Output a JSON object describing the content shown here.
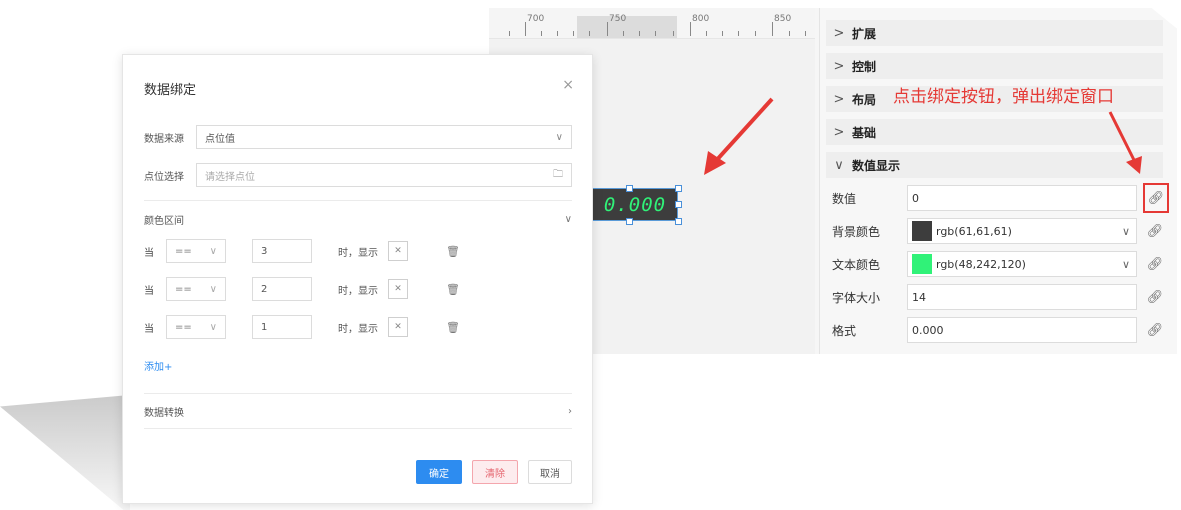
{
  "ruler": {
    "labels": [
      "700",
      "750",
      "800",
      "850"
    ]
  },
  "widget": {
    "display_value": "0.000"
  },
  "properties": {
    "groups": [
      {
        "chevron": ">",
        "label": "扩展"
      },
      {
        "chevron": ">",
        "label": "控制"
      },
      {
        "chevron": ">",
        "label": "布局"
      },
      {
        "chevron": ">",
        "label": "基础"
      },
      {
        "chevron": "∨",
        "label": "数值显示"
      }
    ],
    "rows": [
      {
        "label": "数值",
        "value": "0"
      },
      {
        "label": "背景颜色",
        "value": "rgb(61,61,61)",
        "swatch": "#3d3d3d"
      },
      {
        "label": "文本颜色",
        "value": "rgb(48,242,120)",
        "swatch": "#30f278"
      },
      {
        "label": "字体大小",
        "value": "14"
      },
      {
        "label": "格式",
        "value": "0.000"
      }
    ],
    "select_arrow": "∨"
  },
  "annotation": {
    "text": "点击绑定按钮，弹出绑定窗口"
  },
  "dialog": {
    "title": "数据绑定",
    "close": "×",
    "source_label": "数据来源",
    "source_value": "点位值",
    "point_label": "点位选择",
    "point_placeholder": "请选择点位",
    "color_range_label": "颜色区间",
    "conditions": [
      {
        "when": "当",
        "op": "==",
        "value": "3",
        "show": "时，显示"
      },
      {
        "when": "当",
        "op": "==",
        "value": "2",
        "show": "时，显示"
      },
      {
        "when": "当",
        "op": "==",
        "value": "1",
        "show": "时，显示"
      }
    ],
    "add_label": "添加+",
    "convert_label": "数据转换",
    "ok_label": "确定",
    "clear_label": "清除",
    "cancel_label": "取消"
  },
  "colors": {
    "accent": "#2d8cf0",
    "annotation": "#e53935",
    "display_text": "#30f278",
    "display_bg": "#3d3d3d"
  }
}
